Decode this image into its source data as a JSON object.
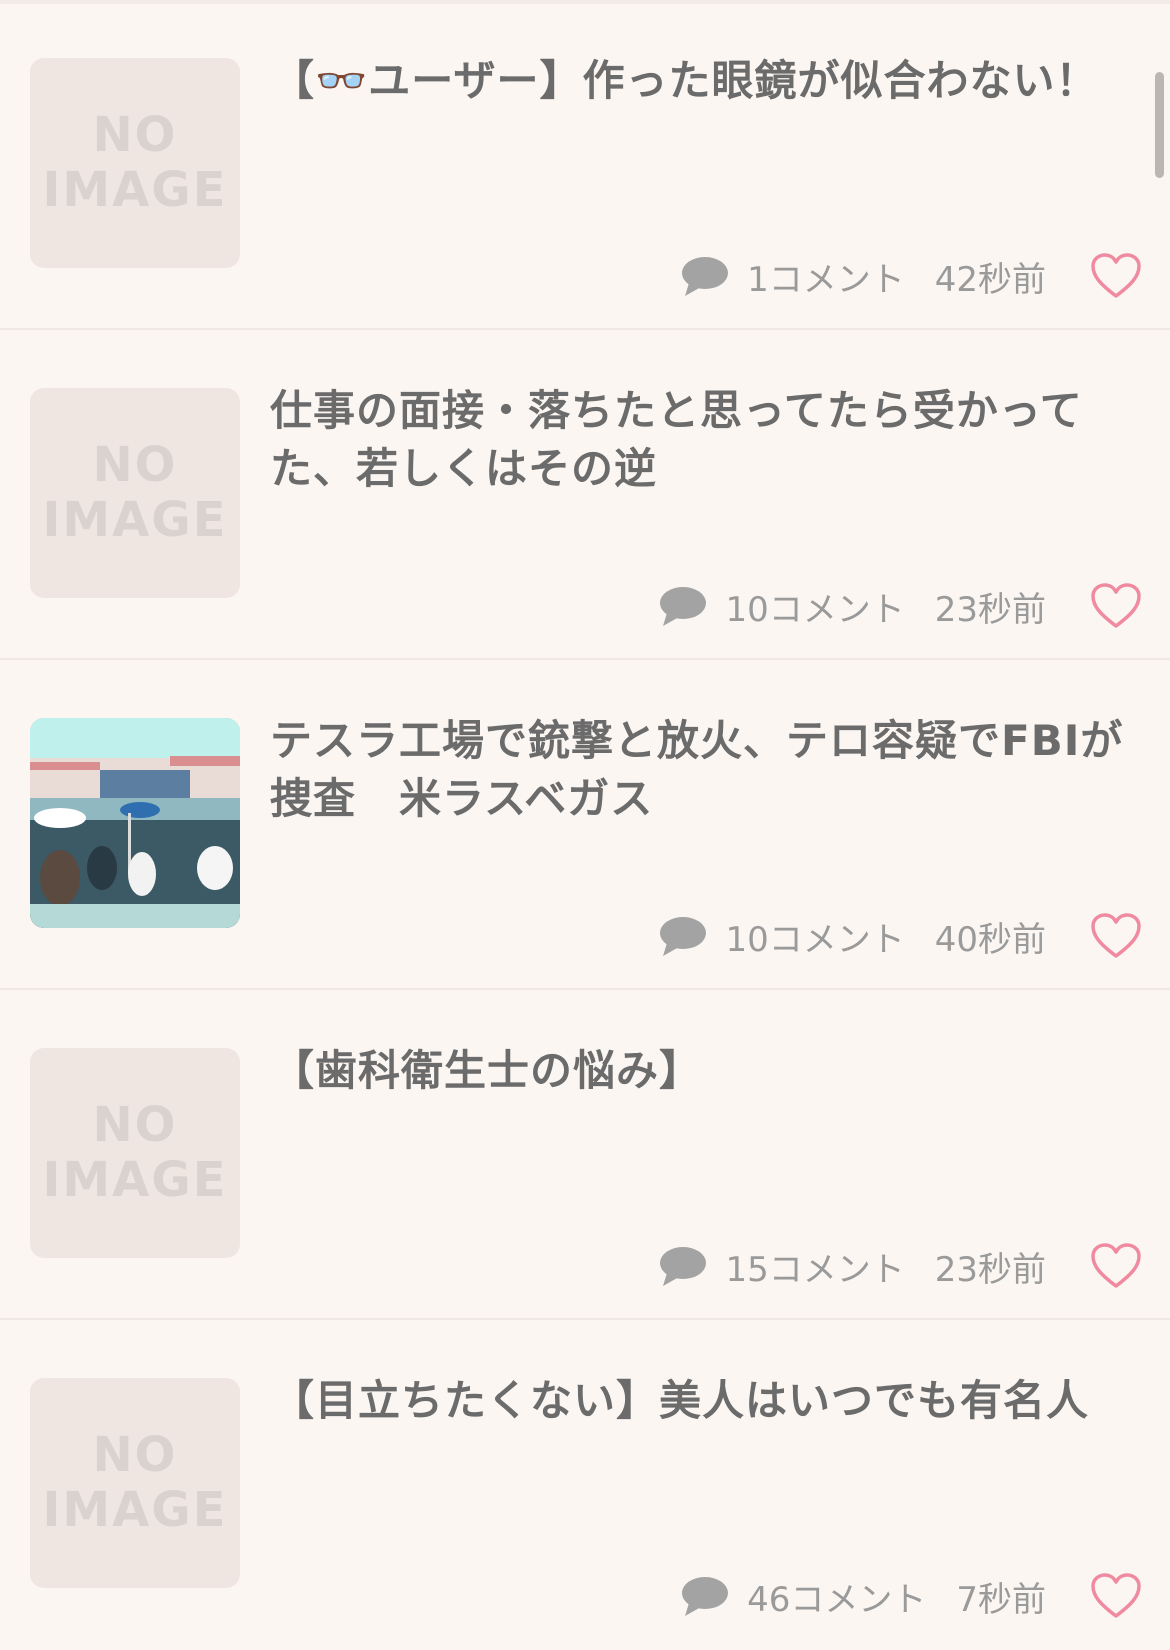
{
  "placeholder": {
    "line1": "NO",
    "line2": "IMAGE"
  },
  "posts": [
    {
      "title": "【👓ユーザー】作った眼鏡が似合わない！",
      "comments": "1コメント",
      "time": "42秒前",
      "has_image": false
    },
    {
      "title": "仕事の面接・落ちたと思ってたら受かってた、若しくはその逆",
      "comments": "10コメント",
      "time": "23秒前",
      "has_image": false
    },
    {
      "title": "テスラ工場で銃撃と放火、テロ容疑でFBIが捜査　米ラスベガス",
      "comments": "10コメント",
      "time": "40秒前",
      "has_image": true
    },
    {
      "title": "【歯科衛生士の悩み】",
      "comments": "15コメント",
      "time": "23秒前",
      "has_image": false
    },
    {
      "title": "【目立ちたくない】美人はいつでも有名人",
      "comments": "46コメント",
      "time": "7秒前",
      "has_image": false
    }
  ],
  "colors": {
    "background": "#fbf6f2",
    "title_text": "#6b6b6b",
    "meta_text": "#9a9a9a",
    "heart": "#f08aa0",
    "placeholder_bg": "#efe6e1"
  },
  "icons": {
    "comment": "speech-bubble-icon",
    "like": "heart-icon"
  }
}
